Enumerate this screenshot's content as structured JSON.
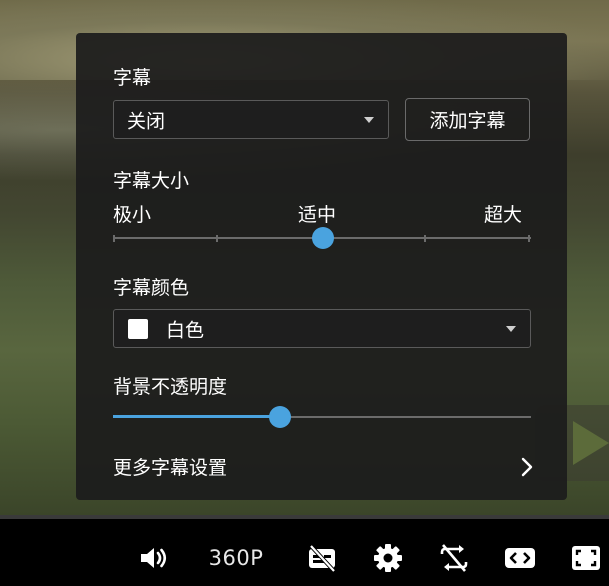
{
  "subtitle_panel": {
    "subtitle_label": "字幕",
    "subtitle_select": {
      "value": "关闭"
    },
    "add_subtitle_button": "添加字幕",
    "size_label": "字幕大小",
    "size_slider": {
      "min_label": "极小",
      "mid_label": "适中",
      "max_label": "超大",
      "steps": 5,
      "value_index": 2
    },
    "color_label": "字幕颜色",
    "color_select": {
      "value": "白色",
      "swatch": "#ffffff"
    },
    "opacity_label": "背景不透明度",
    "opacity_slider": {
      "value": 0.4
    },
    "more_settings": "更多字幕设置"
  },
  "controls": {
    "quality": "360P",
    "icons": [
      "volume-icon",
      "subtitles-off-icon",
      "settings-gear-icon",
      "loop-off-icon",
      "widescreen-icon",
      "fullscreen-icon"
    ]
  },
  "colors": {
    "accent": "#4aa3df",
    "panel_bg": "#1c1c1c",
    "track": "#6b6b6b"
  }
}
